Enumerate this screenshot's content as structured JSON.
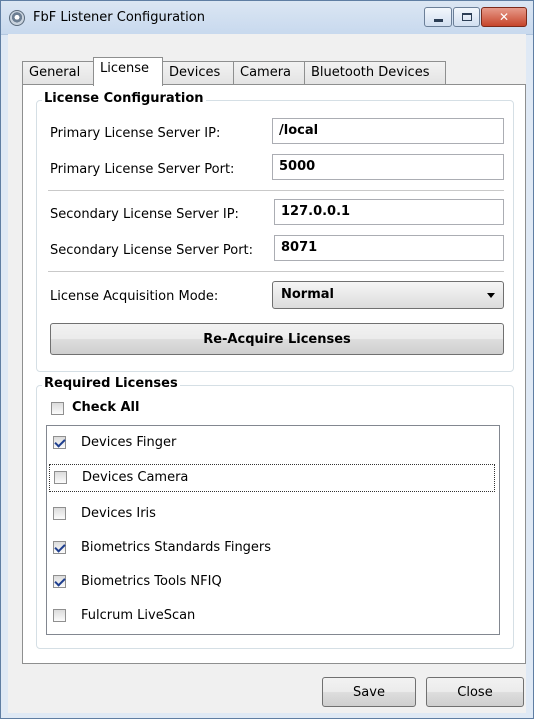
{
  "window": {
    "title": "FbF Listener Configuration",
    "icon": "gear-logo-icon",
    "controls": {
      "minimize": "minimize-icon",
      "maximize": "maximize-icon",
      "close": "close-icon"
    }
  },
  "tabs": [
    {
      "label": "General",
      "active": false
    },
    {
      "label": "License",
      "active": true
    },
    {
      "label": "Devices",
      "active": false
    },
    {
      "label": "Camera",
      "active": false
    },
    {
      "label": "Bluetooth Devices",
      "active": false
    }
  ],
  "license_config": {
    "title": "License Configuration",
    "primary_ip_label": "Primary License Server IP:",
    "primary_ip_value": "/local",
    "primary_port_label": "Primary License Server Port:",
    "primary_port_value": "5000",
    "secondary_ip_label": "Secondary License Server IP:",
    "secondary_ip_value": "127.0.0.1",
    "secondary_port_label": "Secondary License Server Port:",
    "secondary_port_value": "8071",
    "mode_label": "License Acquisition Mode:",
    "mode_value": "Normal",
    "reacquire_label": "Re-Acquire Licenses"
  },
  "required_licenses": {
    "title": "Required Licenses",
    "check_all_label": "Check All",
    "check_all_checked": false,
    "items": [
      {
        "label": "Devices Finger",
        "checked": true
      },
      {
        "label": "Devices Camera",
        "checked": false
      },
      {
        "label": "Devices Iris",
        "checked": false
      },
      {
        "label": "Biometrics Standards Fingers",
        "checked": true
      },
      {
        "label": "Biometrics Tools NFIQ",
        "checked": true
      },
      {
        "label": "Fulcrum LiveScan",
        "checked": false
      }
    ]
  },
  "footer": {
    "save_label": "Save",
    "close_label": "Close"
  },
  "colors": {
    "titlebar": "#c8d9ee",
    "close_button": "#c6452b",
    "panel_background": "#ffffff",
    "window_background": "#f0f0f0"
  }
}
